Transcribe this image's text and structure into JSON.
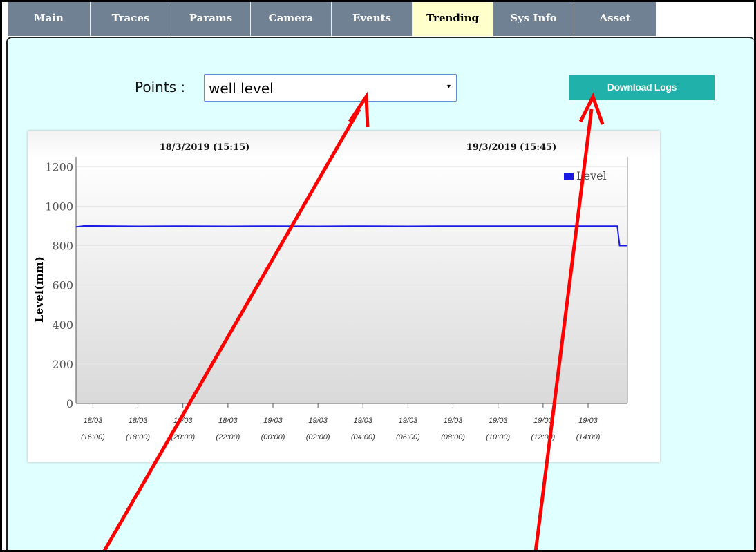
{
  "tabs": [
    {
      "label": "Main"
    },
    {
      "label": "Traces"
    },
    {
      "label": "Params"
    },
    {
      "label": "Camera"
    },
    {
      "label": "Events"
    },
    {
      "label": "Trending",
      "active": true
    },
    {
      "label": "Sys Info"
    },
    {
      "label": "Asset"
    }
  ],
  "points": {
    "label": "Points  :",
    "selected": "well level",
    "arrow": "▾"
  },
  "download": {
    "label": "Download Logs"
  },
  "chart_data": {
    "type": "line",
    "header_left": "18/3/2019 (15:15)",
    "header_right": "19/3/2019 (15:45)",
    "ylabel": "Level(mm)",
    "ylim": [
      0,
      1250
    ],
    "yticks": [
      "0",
      "200",
      "400",
      "600",
      "800",
      "1000",
      "1200"
    ],
    "x_range_hours": [
      15.25,
      39.75
    ],
    "xticks": [
      {
        "d": "18/03",
        "t": "(16:00)",
        "h": 16
      },
      {
        "d": "18/03",
        "t": "(18:00)",
        "h": 18
      },
      {
        "d": "18/03",
        "t": "(20:00)",
        "h": 20
      },
      {
        "d": "18/03",
        "t": "(22:00)",
        "h": 22
      },
      {
        "d": "19/03",
        "t": "(00:00)",
        "h": 24
      },
      {
        "d": "19/03",
        "t": "(02:00)",
        "h": 26
      },
      {
        "d": "19/03",
        "t": "(04:00)",
        "h": 28
      },
      {
        "d": "19/03",
        "t": "(06:00)",
        "h": 30
      },
      {
        "d": "19/03",
        "t": "(08:00)",
        "h": 32
      },
      {
        "d": "19/03",
        "t": "(10:00)",
        "h": 34
      },
      {
        "d": "19/03",
        "t": "(12:00)",
        "h": 36
      },
      {
        "d": "19/03",
        "t": "(14:00)",
        "h": 38
      }
    ],
    "series": [
      {
        "name": "Level",
        "color": "#1a1ae6",
        "points": [
          [
            15.25,
            895
          ],
          [
            15.6,
            900
          ],
          [
            16.0,
            900
          ],
          [
            18.0,
            898
          ],
          [
            20.0,
            899
          ],
          [
            22.0,
            898
          ],
          [
            24.0,
            899
          ],
          [
            26.0,
            898
          ],
          [
            28.0,
            899
          ],
          [
            30.0,
            898
          ],
          [
            32.0,
            899
          ],
          [
            34.0,
            899
          ],
          [
            36.0,
            899
          ],
          [
            38.0,
            899
          ],
          [
            39.3,
            899
          ],
          [
            39.4,
            800
          ],
          [
            39.75,
            800
          ]
        ]
      }
    ],
    "legend_position": "top-right",
    "grid": true
  },
  "colors": {
    "tab_bg": "#6f8193",
    "tab_active_bg": "#ffffcc",
    "panel_bg": "#e0ffff",
    "button_bg": "#20b2aa",
    "annotation_arrow": "#ff0000"
  }
}
